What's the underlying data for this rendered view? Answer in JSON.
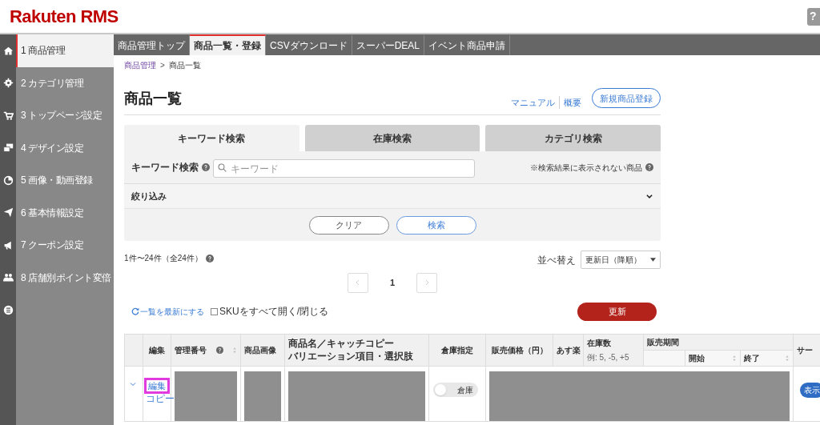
{
  "header": {
    "logo": "Rakuten RMS",
    "help_button": "?"
  },
  "sidebar": {
    "items": [
      {
        "number": "1",
        "label": "商品管理",
        "selected": true
      },
      {
        "number": "2",
        "label": "カテゴリ管理",
        "selected": false
      },
      {
        "number": "3",
        "label": "トップページ設定",
        "selected": false
      },
      {
        "number": "4",
        "label": "デザイン設定",
        "selected": false
      },
      {
        "number": "5",
        "label": "画像・動画登録",
        "selected": false
      },
      {
        "number": "6",
        "label": "基本情報設定",
        "selected": false
      },
      {
        "number": "7",
        "label": "クーポン設定",
        "selected": false
      },
      {
        "number": "8",
        "label": "店舗別ポイント変倍",
        "selected": false
      },
      {
        "selected": false
      }
    ]
  },
  "tabs": [
    {
      "label": "商品管理トップ",
      "selected": false
    },
    {
      "label": "商品一覧・登録",
      "selected": true
    },
    {
      "label": "CSVダウンロード",
      "selected": false
    },
    {
      "label": "スーパーDEAL",
      "selected": false
    },
    {
      "label": "イベント商品申請",
      "selected": false
    }
  ],
  "breadcrumb": [
    {
      "label": "商品管理",
      "kind": "link"
    },
    {
      "label": ">",
      "kind": "separator"
    },
    {
      "label": "商品一覧",
      "kind": "text"
    }
  ],
  "page_title": "商品一覧",
  "header_links": [
    "マニュアル",
    "概要"
  ],
  "new_button": "新規商品登録",
  "search": {
    "tabs": [
      {
        "label": "キーワード検索",
        "selected": true
      },
      {
        "label": "在庫検索",
        "selected": false
      },
      {
        "label": "カテゴリ検索",
        "selected": false
      }
    ],
    "keyword_label": "キーワード検索",
    "placeholder": "キーワード",
    "hidden_note": "※検索結果に表示されない商品",
    "filter_label": "絞り込み",
    "filter_expanded": false,
    "buttons": [
      {
        "label": "クリア",
        "kind": "plain"
      },
      {
        "label": "検索",
        "kind": "primary"
      }
    ]
  },
  "result_count": "1件〜24件（全24件）",
  "sort": {
    "label": "並べ替え",
    "value": "更新日（降順）"
  },
  "pagination": {
    "page": "1"
  },
  "refresh_link": "一覧を最新にする",
  "sku_toggle": {
    "label": "SKUをすべて開く/閉じる",
    "checked": false
  },
  "update_button": "更新",
  "table": {
    "columns": [
      {
        "sortable": false
      },
      {
        "label": "編集",
        "sortable": false
      },
      {
        "label": "管理番号",
        "help": true,
        "sortable": true
      },
      {
        "label": "商品画像",
        "sortable": false
      },
      {
        "lines": [
          "商品名／キャッチコピー",
          "バリエーション項目・選択肢"
        ],
        "sortable": false
      },
      {
        "label": "倉庫指定",
        "sortable": false
      },
      {
        "label": "販売価格（円）",
        "sortable": false
      },
      {
        "label": "あす楽",
        "sortable": false
      },
      {
        "label": "在庫数",
        "note": "例: 5, -5, +5",
        "sortable": false
      },
      {
        "label": "販売期間",
        "kind": "group",
        "sub": [
          {
            "sortable": false
          },
          {
            "label": "開始",
            "sortable": true
          },
          {
            "label": "終了",
            "sortable": true
          }
        ]
      },
      {
        "label": "サー",
        "sortable": false
      }
    ],
    "rows": [
      {
        "expanded": false,
        "edit_link": "編集",
        "edit_highlighted": true,
        "copy_link": "コピー",
        "warehouse": {
          "label": "倉庫",
          "on": false
        },
        "status_badge": "表示"
      }
    ]
  }
}
